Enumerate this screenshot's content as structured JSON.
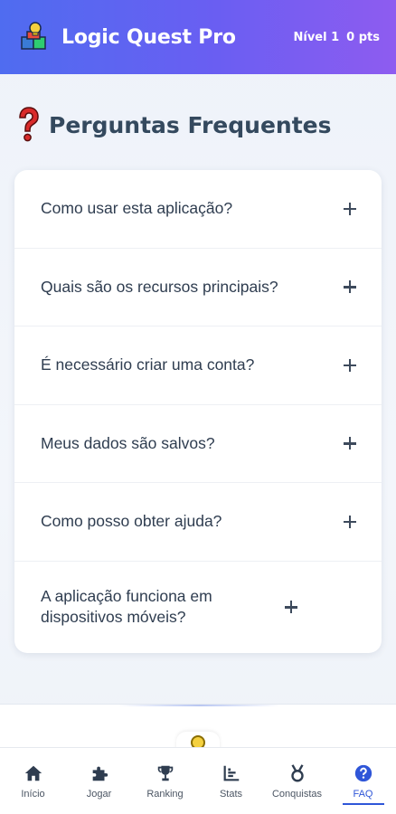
{
  "header": {
    "app_title": "Logic Quest Pro",
    "level": "Nível 1",
    "points": "0 pts",
    "logo_icon": "puzzle-trophy-logo-icon"
  },
  "page": {
    "title": "Perguntas Frequentes",
    "title_icon": "question-mark-icon"
  },
  "faq": {
    "items": [
      {
        "question": "Como usar esta aplicação?"
      },
      {
        "question": "Quais são os recursos principais?"
      },
      {
        "question": "É necessário criar uma conta?"
      },
      {
        "question": "Meus dados são salvos?"
      },
      {
        "question": "Como posso obter ajuda?"
      },
      {
        "question": "A aplicação funciona em dispositivos móveis?"
      }
    ],
    "expand_icon": "plus-icon"
  },
  "nav": {
    "items": [
      {
        "label": "Início",
        "icon": "home-icon"
      },
      {
        "label": "Jogar",
        "icon": "puzzle-icon"
      },
      {
        "label": "Ranking",
        "icon": "trophy-icon"
      },
      {
        "label": "Stats",
        "icon": "bar-chart-icon"
      },
      {
        "label": "Conquistas",
        "icon": "medal-icon"
      },
      {
        "label": "FAQ",
        "icon": "question-circle-icon",
        "active": true
      }
    ]
  },
  "colors": {
    "header_start": "#4f6cf0",
    "header_end": "#8e5cf0",
    "accent": "#2f56d8",
    "title_text": "#34495e",
    "question_text": "#2f3d50"
  }
}
